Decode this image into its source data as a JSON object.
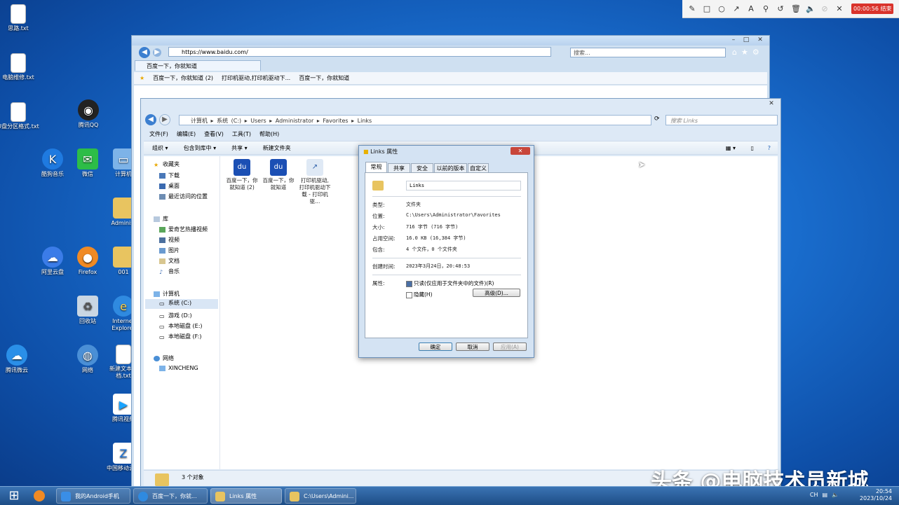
{
  "desktop": {
    "icons": [
      {
        "label": "思路.txt"
      },
      {
        "label": "电脑维修.txt"
      },
      {
        "label": "U盘分区格式.txt"
      },
      {
        "label": "腾讯QQ"
      },
      {
        "label": "酷狗音乐"
      },
      {
        "label": "微信"
      },
      {
        "label": "计算机"
      },
      {
        "label": "Administ"
      },
      {
        "label": "阿里云盘"
      },
      {
        "label": "Firefox"
      },
      {
        "label": "001"
      },
      {
        "label": "回收站"
      },
      {
        "label": "Internet Explorer"
      },
      {
        "label": "腾讯微云"
      },
      {
        "label": "网络"
      },
      {
        "label": "新建文本文档.txt"
      },
      {
        "label": "腾讯视频"
      },
      {
        "label": "中国移动云盘"
      }
    ]
  },
  "recorder": {
    "time": "00:00:56 结束"
  },
  "ie": {
    "url": "https://www.baidu.com/",
    "search_placeholder": "搜索...",
    "tab": "百度一下，你就知道",
    "favorites": [
      "百度一下，你就知道 (2)",
      "打印机驱动,打印机驱动下...",
      "百度一下，你就知道"
    ]
  },
  "explorer": {
    "path": "计算机 ▸ 系统 (C:) ▸ Users ▸ Administrator ▸ Favorites ▸ Links",
    "search_placeholder": "搜索 Links",
    "menu": [
      "文件(F)",
      "编辑(E)",
      "查看(V)",
      "工具(T)",
      "帮助(H)"
    ],
    "commands": [
      "组织 ▾",
      "包含到库中 ▾",
      "共享 ▾",
      "新建文件夹"
    ],
    "nav": {
      "favorites_header": "收藏夹",
      "favorites": [
        "下载",
        "桌面",
        "最近访问的位置"
      ],
      "library_header": "库",
      "library": [
        "爱奇艺热播视频",
        "视频",
        "图片",
        "文档",
        "音乐"
      ],
      "computer_header": "计算机",
      "computer": [
        "系统 (C:)",
        "游戏 (D:)",
        "本地磁盘 (E:)",
        "本地磁盘 (F:)"
      ],
      "network_header": "网络",
      "network": [
        "XINCHENG"
      ]
    },
    "files": [
      {
        "name": "百度一下，你就知道 (2)"
      },
      {
        "name": "百度一下，你就知道"
      },
      {
        "name": "打印机驱动,打印机驱动下载 - 打印机驱..."
      }
    ],
    "status": "3 个对象"
  },
  "dialog": {
    "title": "Links 属性",
    "tabs": [
      "常规",
      "共享",
      "安全",
      "以前的版本",
      "自定义"
    ],
    "name": "Links",
    "type_label": "类型:",
    "type_value": "文件夹",
    "location_label": "位置:",
    "location_value": "C:\\Users\\Administrator\\Favorites",
    "size_label": "大小:",
    "size_value": "716 字节 (716 字节)",
    "disk_label": "占用空间:",
    "disk_value": "16.0 KB (16,384 字节)",
    "contains_label": "包含:",
    "contains_value": "4 个文件，0 个文件夹",
    "created_label": "创建时间:",
    "created_value": "2023年3月24日，20:48:53",
    "attr_label": "属性:",
    "readonly": "只读(仅应用于文件夹中的文件)(R)",
    "hidden": "隐藏(H)",
    "advanced": "高级(D)...",
    "ok": "确定",
    "cancel": "取消",
    "apply": "应用(A)"
  },
  "taskbar": {
    "items": [
      "我的Android手机",
      "百度一下，你就...",
      "Links 属性",
      "C:\\Users\\Admini..."
    ],
    "tray_lang": "CH",
    "time": "20:54",
    "date": "2023/10/24"
  },
  "watermark": "头条 @电脑技术员新城"
}
